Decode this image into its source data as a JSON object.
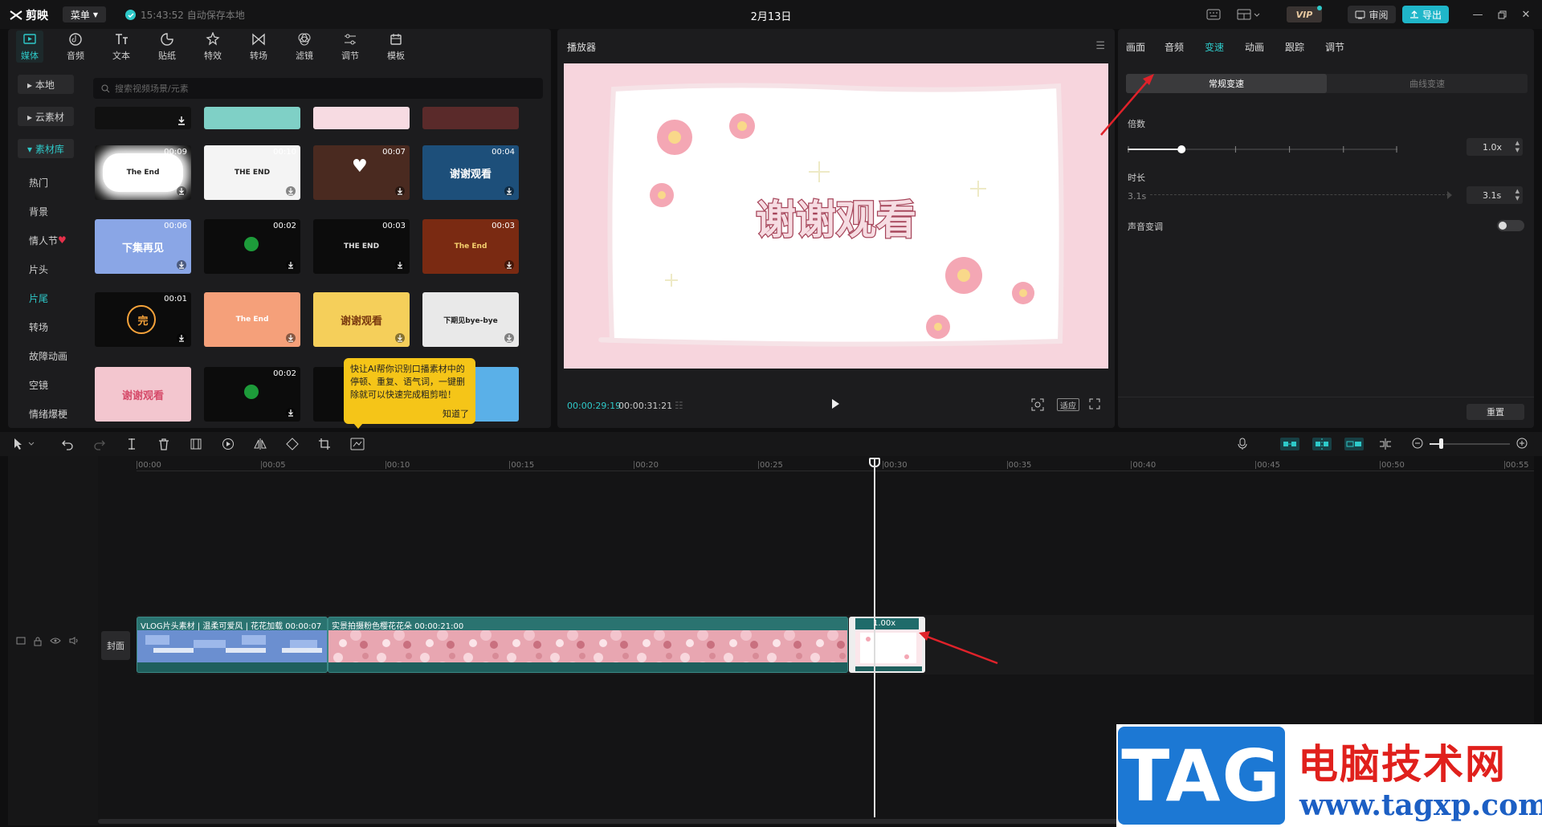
{
  "titlebar": {
    "app_name": "剪映",
    "menu_label": "菜单",
    "autosave_text": "15:43:52 自动保存本地",
    "project_title": "2月13日",
    "vip_label": "VIP",
    "review_label": "审阅",
    "export_label": "导出"
  },
  "toolbar_tabs": [
    {
      "label": "媒体",
      "icon": "media-icon"
    },
    {
      "label": "音频",
      "icon": "audio-icon"
    },
    {
      "label": "文本",
      "icon": "text-icon"
    },
    {
      "label": "贴纸",
      "icon": "sticker-icon"
    },
    {
      "label": "特效",
      "icon": "effects-icon"
    },
    {
      "label": "转场",
      "icon": "transition-icon"
    },
    {
      "label": "滤镜",
      "icon": "filter-icon"
    },
    {
      "label": "调节",
      "icon": "adjust-icon"
    },
    {
      "label": "模板",
      "icon": "template-icon"
    }
  ],
  "sidebar": {
    "items": [
      {
        "label": "本地"
      },
      {
        "label": "云素材"
      },
      {
        "label": "素材库"
      },
      {
        "label": "热门"
      },
      {
        "label": "背景"
      },
      {
        "label": "情人节"
      },
      {
        "label": "片头"
      },
      {
        "label": "片尾"
      },
      {
        "label": "转场"
      },
      {
        "label": "故障动画"
      },
      {
        "label": "空镜"
      },
      {
        "label": "情绪爆梗"
      }
    ]
  },
  "search": {
    "placeholder": "搜索视频场景/元素"
  },
  "media_grid": {
    "row1": [
      {
        "duration": "00:09",
        "text": "The End"
      },
      {
        "duration": "00:10",
        "text": "THE END"
      },
      {
        "duration": "00:07",
        "text": ""
      },
      {
        "duration": "00:04",
        "text": "谢谢观看"
      }
    ],
    "row2": [
      {
        "duration": "00:06",
        "text": "下集再见"
      },
      {
        "duration": "00:02",
        "text": ""
      },
      {
        "duration": "00:03",
        "text": "THE END"
      },
      {
        "duration": "00:03",
        "text": "The End"
      }
    ],
    "row3": [
      {
        "duration": "00:01",
        "text": "完"
      },
      {
        "duration": "",
        "text": "The End"
      },
      {
        "duration": "",
        "text": "谢谢观看"
      },
      {
        "duration": "",
        "text": "下期见bye-bye"
      }
    ],
    "row4": [
      {
        "duration": "",
        "text": "谢谢观看"
      },
      {
        "duration": "00:02",
        "text": ""
      }
    ]
  },
  "tooltip": {
    "text": "快让AI帮你识别口播素材中的停顿、重复、语气词，一键删除就可以快速完成粗剪啦！",
    "ok_label": "知道了"
  },
  "player": {
    "title": "播放器",
    "screen_text": "谢谢观看",
    "current_time": "00:00:29:19",
    "total_time": "00:00:31:21",
    "fit_label": "适应"
  },
  "properties": {
    "tabs": [
      "画面",
      "音频",
      "变速",
      "动画",
      "跟踪",
      "调节"
    ],
    "active_tab": "变速",
    "segments": {
      "normal": "常规变速",
      "curve": "曲线变速"
    },
    "multiplier_label": "倍数",
    "multiplier_value": "1.0x",
    "multiplier_fraction": 0.2,
    "duration_label": "时长",
    "duration_start": "3.1s",
    "duration_value": "3.1s",
    "pitch_label": "声音变调",
    "reset_label": "重置"
  },
  "timeline": {
    "ruler": [
      "00:00",
      "00:05",
      "00:10",
      "00:15",
      "00:20",
      "00:25",
      "00:30",
      "00:35",
      "00:40",
      "00:45",
      "00:50",
      "00:55"
    ],
    "cover_label": "封面",
    "clip1_label": "VLOG片头素材 | 温柔可爱风 | 花花加载  00:00:07",
    "clip2_label": "实景拍摄粉色樱花花朵  00:00:21:00",
    "clip3_speed": "1.00x"
  },
  "watermark": {
    "tag": "TAG",
    "site_name": "电脑技术网",
    "url": "www.tagxp.com"
  },
  "colors": {
    "accent": "#2ec9c9",
    "panel": "#1c1c1e",
    "clip_teal": "#1f6b6a"
  }
}
